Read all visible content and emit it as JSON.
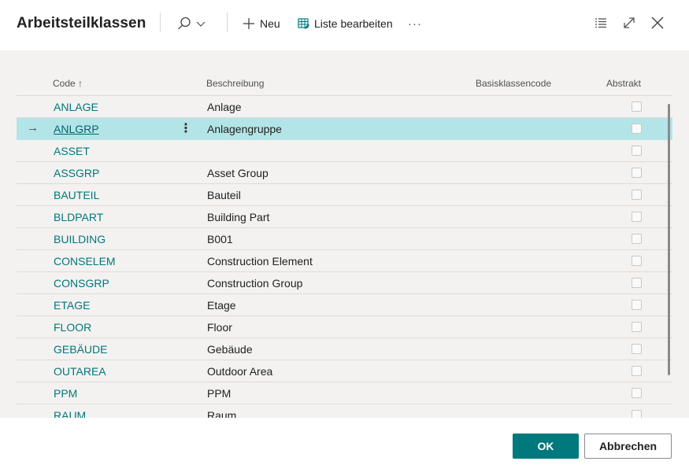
{
  "header": {
    "title": "Arbeitsteilklassen",
    "new_label": "Neu",
    "edit_list_label": "Liste bearbeiten",
    "more_label": "···"
  },
  "columns": {
    "code": "Code ↑",
    "description": "Beschreibung",
    "base_class_code": "Basisklassencode",
    "abstract": "Abstrakt"
  },
  "rows": [
    {
      "code": "ANLAGE",
      "description": "Anlage",
      "selected": false
    },
    {
      "code": "ANLGRP",
      "description": "Anlagengruppe",
      "selected": true
    },
    {
      "code": "ASSET",
      "description": "",
      "selected": false
    },
    {
      "code": "ASSGRP",
      "description": "Asset Group",
      "selected": false
    },
    {
      "code": "BAUTEIL",
      "description": "Bauteil",
      "selected": false
    },
    {
      "code": "BLDPART",
      "description": "Building Part",
      "selected": false
    },
    {
      "code": "BUILDING",
      "description": "B001",
      "selected": false
    },
    {
      "code": "CONSELEM",
      "description": "Construction Element",
      "selected": false
    },
    {
      "code": "CONSGRP",
      "description": "Construction Group",
      "selected": false
    },
    {
      "code": "ETAGE",
      "description": "Etage",
      "selected": false
    },
    {
      "code": "FLOOR",
      "description": "Floor",
      "selected": false
    },
    {
      "code": "GEBÄUDE",
      "description": "Gebäude",
      "selected": false
    },
    {
      "code": "OUTAREA",
      "description": "Outdoor Area",
      "selected": false
    },
    {
      "code": "PPM",
      "description": "PPM",
      "selected": false
    },
    {
      "code": "RAUM",
      "description": "Raum",
      "selected": false
    }
  ],
  "footer": {
    "ok_label": "OK",
    "cancel_label": "Abbrechen"
  },
  "colors": {
    "accent": "#00797d",
    "link": "#00777b",
    "selected_row": "#b3e5e8"
  }
}
